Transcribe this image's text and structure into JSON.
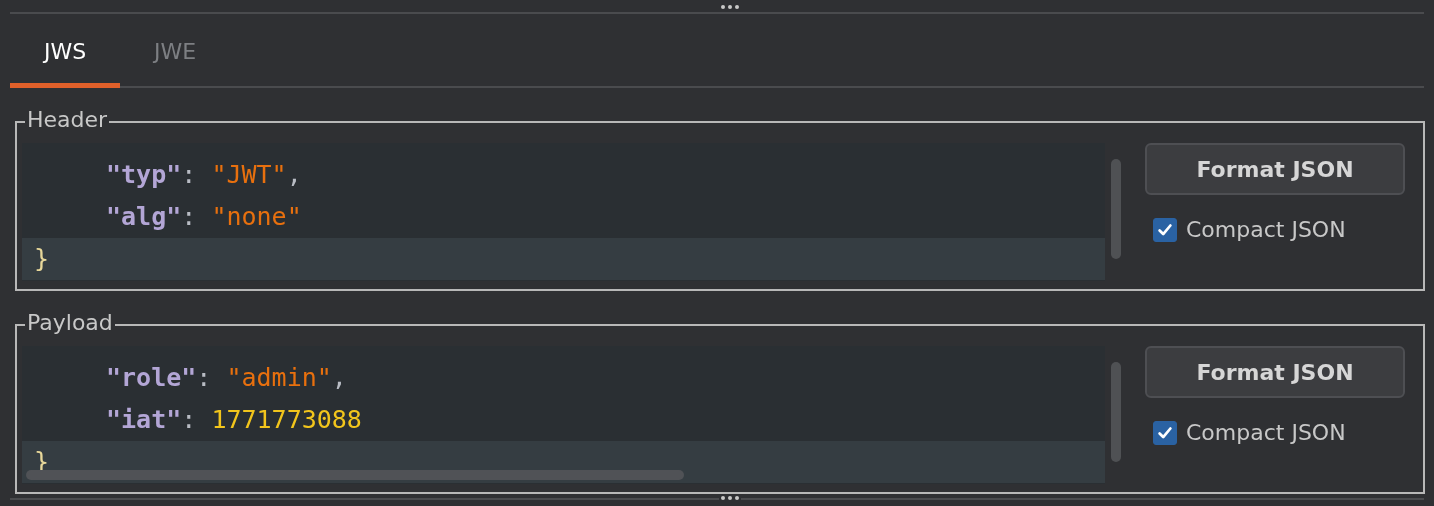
{
  "tabs": [
    {
      "label": "JWS",
      "selected": true
    },
    {
      "label": "JWE",
      "selected": false
    }
  ],
  "sections": [
    {
      "title": "Header",
      "horizontal_scroll": false,
      "lines": [
        {
          "current": false,
          "tokens": [
            {
              "kind": "key",
              "text": "\"typ\""
            },
            {
              "kind": "punct",
              "text": ": "
            },
            {
              "kind": "string",
              "text": "\"JWT\""
            },
            {
              "kind": "punct",
              "text": ","
            }
          ]
        },
        {
          "current": false,
          "tokens": [
            {
              "kind": "key",
              "text": "\"alg\""
            },
            {
              "kind": "punct",
              "text": ": "
            },
            {
              "kind": "string",
              "text": "\"none\""
            }
          ]
        },
        {
          "current": true,
          "tokens": [
            {
              "kind": "brace",
              "text": "}"
            }
          ]
        }
      ],
      "button": "Format JSON",
      "checkbox": {
        "label": "Compact JSON",
        "checked": true
      }
    },
    {
      "title": "Payload",
      "horizontal_scroll": true,
      "lines": [
        {
          "current": false,
          "tokens": [
            {
              "kind": "key",
              "text": "\"role\""
            },
            {
              "kind": "punct",
              "text": ": "
            },
            {
              "kind": "string",
              "text": "\"admin\""
            },
            {
              "kind": "punct",
              "text": ","
            }
          ]
        },
        {
          "current": false,
          "tokens": [
            {
              "kind": "key",
              "text": "\"iat\""
            },
            {
              "kind": "punct",
              "text": ": "
            },
            {
              "kind": "number",
              "text": "1771773088"
            }
          ]
        },
        {
          "current": true,
          "tokens": [
            {
              "kind": "brace",
              "text": "}"
            }
          ]
        }
      ],
      "button": "Format JSON",
      "checkbox": {
        "label": "Compact JSON",
        "checked": true
      }
    }
  ]
}
